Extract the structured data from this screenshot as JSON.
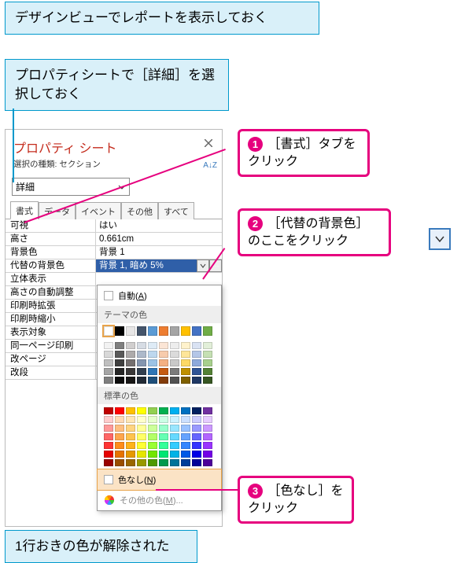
{
  "callouts": {
    "top1": "デザインビューでレポートを表示しておく",
    "top2": "プロパティシートで［詳細］を選択しておく",
    "bottom": "1行おきの色が解除された"
  },
  "steps": {
    "s1": {
      "num": "1",
      "text": "［書式］タブをクリック"
    },
    "s2": {
      "num": "2",
      "text": "［代替の背景色］のここをクリック"
    },
    "s3": {
      "num": "3",
      "text": "［色なし］をクリック"
    }
  },
  "panel": {
    "title": "プロパティ シート",
    "subtitle": "選択の種類: セクション",
    "sort": "A↓Z",
    "selector": "詳細",
    "tabs": {
      "t1": "書式",
      "t2": "データ",
      "t3": "イベント",
      "t4": "その他",
      "t5": "すべて"
    },
    "props": [
      {
        "label": "可視",
        "value": "はい"
      },
      {
        "label": "高さ",
        "value": "0.661cm"
      },
      {
        "label": "背景色",
        "value": "背景 1"
      },
      {
        "label": "代替の背景色",
        "value": "背景 1, 暗め 5%"
      },
      {
        "label": "立体表示",
        "value": ""
      },
      {
        "label": "高さの自動調整",
        "value": ""
      },
      {
        "label": "印刷時拡張",
        "value": ""
      },
      {
        "label": "印刷時縮小",
        "value": ""
      },
      {
        "label": "表示対象",
        "value": ""
      },
      {
        "label": "同一ページ印刷",
        "value": ""
      },
      {
        "label": "改ページ",
        "value": ""
      },
      {
        "label": "改段",
        "value": ""
      }
    ]
  },
  "colorpicker": {
    "auto_prefix": "自動(",
    "auto_key": "A",
    "auto_suffix": ")",
    "theme_header": "テーマの色",
    "standard_header": "標準の色",
    "nocolor_prefix": "色なし(",
    "nocolor_key": "N",
    "nocolor_suffix": ")",
    "more_prefix": "その他の色(",
    "more_key": "M",
    "more_suffix": ")..."
  },
  "colors": {
    "theme_row": [
      "#ffffff",
      "#000000",
      "#e7e6e6",
      "#44546a",
      "#5b9bd5",
      "#ed7d31",
      "#a5a5a5",
      "#ffc000",
      "#4472c4",
      "#70ad47"
    ],
    "theme_shades": [
      [
        "#f2f2f2",
        "#7f7f7f",
        "#d0cece",
        "#d6dce4",
        "#deebf6",
        "#fbe5d5",
        "#ededed",
        "#fff2cc",
        "#d9e2f3",
        "#e2efd9"
      ],
      [
        "#d8d8d8",
        "#595959",
        "#aeabab",
        "#adb9ca",
        "#bdd7ee",
        "#f7cbac",
        "#dbdbdb",
        "#fee599",
        "#b4c6e7",
        "#c5e0b3"
      ],
      [
        "#bfbfbf",
        "#3f3f3f",
        "#757070",
        "#8496b0",
        "#9cc3e5",
        "#f4b183",
        "#c9c9c9",
        "#fdd966",
        "#8eaadb",
        "#a8d08d"
      ],
      [
        "#a5a5a5",
        "#262626",
        "#3a3838",
        "#323f4f",
        "#2e75b5",
        "#c55a11",
        "#7b7b7b",
        "#bf9000",
        "#2f5496",
        "#538135"
      ],
      [
        "#7f7f7f",
        "#0c0c0c",
        "#171616",
        "#222a35",
        "#1e4e79",
        "#833c0b",
        "#525252",
        "#7f6000",
        "#1f3864",
        "#375623"
      ]
    ],
    "standard": [
      [
        "#c00000",
        "#ff0000",
        "#ffc000",
        "#ffff00",
        "#92d050",
        "#00b050",
        "#00b0f0",
        "#0070c0",
        "#002060",
        "#7030a0"
      ],
      [
        "#ffcccc",
        "#ffd9b3",
        "#ffe6b3",
        "#ffffcc",
        "#e6ffcc",
        "#ccffe6",
        "#ccf2ff",
        "#cce0ff",
        "#ccccff",
        "#e6ccff"
      ],
      [
        "#ff9999",
        "#ffbf80",
        "#ffd480",
        "#ffff99",
        "#ccff99",
        "#99ffcc",
        "#99e6ff",
        "#99c2ff",
        "#9999ff",
        "#cc99ff"
      ],
      [
        "#ff6666",
        "#ffa64d",
        "#ffc34d",
        "#ffff66",
        "#b3ff66",
        "#66ffb3",
        "#66d9ff",
        "#66a3ff",
        "#6666ff",
        "#b366ff"
      ],
      [
        "#ff3333",
        "#ff8c1a",
        "#ffb31a",
        "#ffff33",
        "#99ff33",
        "#33ff99",
        "#33ccff",
        "#3385ff",
        "#3333ff",
        "#9933ff"
      ],
      [
        "#e60000",
        "#e67300",
        "#e69900",
        "#e6e600",
        "#73e600",
        "#00e673",
        "#00b3e6",
        "#0059e6",
        "#0000e6",
        "#7300e6"
      ],
      [
        "#990000",
        "#994d00",
        "#996600",
        "#999900",
        "#4d9900",
        "#00994d",
        "#007399",
        "#003d99",
        "#000099",
        "#4d0099"
      ]
    ]
  }
}
